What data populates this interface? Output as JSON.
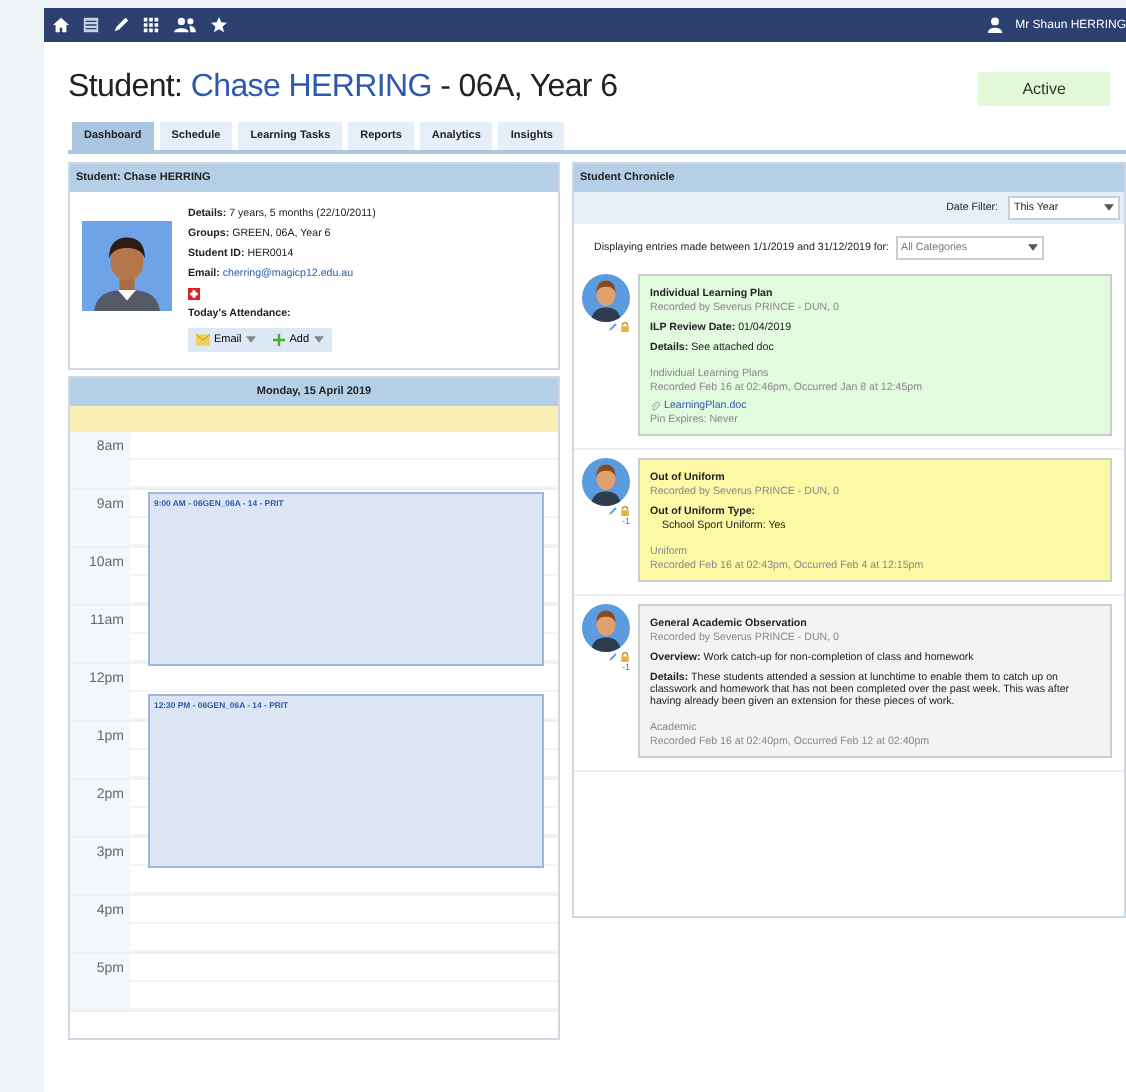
{
  "topbar": {
    "user": "Mr Shaun HERRING"
  },
  "header": {
    "prefix": "Student:",
    "name": "Chase HERRING",
    "suffix": "- 06A, Year 6",
    "status": "Active"
  },
  "tabs": [
    {
      "label": "Dashboard",
      "selected": true
    },
    {
      "label": "Schedule",
      "selected": false
    },
    {
      "label": "Learning Tasks",
      "selected": false
    },
    {
      "label": "Reports",
      "selected": false
    },
    {
      "label": "Analytics",
      "selected": false
    },
    {
      "label": "Insights",
      "selected": false
    }
  ],
  "student_panel": {
    "title": "Student: Chase HERRING",
    "details": [
      {
        "label": "Details:",
        "value": "7 years, 5 months (22/10/2011)"
      },
      {
        "label": "Groups:",
        "value": "GREEN, 06A, Year 6"
      },
      {
        "label": "Student ID:",
        "value": "HER0014"
      }
    ],
    "email_label": "Email:",
    "email": "cherring@magicp12.edu.au",
    "attendance_label": "Today's Attendance:",
    "buttons": [
      {
        "label": "Email",
        "kind": "email"
      },
      {
        "label": "Add",
        "kind": "add"
      }
    ]
  },
  "calendar": {
    "title": "Monday, 15 April 2019",
    "hours": [
      "8am",
      "9am",
      "10am",
      "11am",
      "12pm",
      "1pm",
      "2pm",
      "3pm",
      "4pm",
      "5pm"
    ],
    "events": [
      {
        "label": "9:00 AM - 06GEN_06A - 14 - PRIT"
      },
      {
        "label": "12:30 PM - 06GEN_06A - 14 - PRIT"
      }
    ]
  },
  "chronicle": {
    "title": "Student Chronicle",
    "date_filter_label": "Date Filter:",
    "date_filter": "This Year",
    "range_text": "Displaying entries made between 1/1/2019 and 31/12/2019 for:",
    "category": "All Categories",
    "entries": [
      {
        "title": "Individual Learning Plan",
        "recorded_by": "Recorded by Severus PRINCE - DUN, 0",
        "color": "#e2fbde",
        "fields": [
          {
            "label": "ILP Review Date:",
            "value": "01/04/2019",
            "kind": "inline"
          },
          {
            "label": "Details:",
            "value": "See attached doc",
            "kind": "inline"
          }
        ],
        "category": "Individual Learning Plans",
        "timestamp": "Recorded Feb 16 at 02:46pm, Occurred Jan 8 at 12:45pm",
        "attachment": "LearningPlan.doc",
        "pin": "Pin Expires: Never"
      },
      {
        "title": "Out of Uniform",
        "recorded_by": "Recorded by Severus PRINCE - DUN, 0",
        "color": "#fbf9a6",
        "count": "-1",
        "fields": [
          {
            "label": "Out of Uniform Type:",
            "value": "School Sport Uniform: Yes",
            "kind": "block"
          }
        ],
        "category": "Uniform",
        "timestamp": "Recorded Feb 16 at 02:43pm, Occurred Feb 4 at 12:15pm"
      },
      {
        "title": "General Academic Observation",
        "recorded_by": "Recorded by Severus PRINCE - DUN, 0",
        "color": "#f3f3f3",
        "count": "-1",
        "fields": [
          {
            "label": "Overview:",
            "value": "Work catch-up for non-completion of class and homework",
            "kind": "inline"
          },
          {
            "label": "Details:",
            "value": "These students attended a session at lunchtime to enable them to catch up on classwork and homework that has not been completed over the past week. This was after having already been given an extension for these pieces of work.",
            "kind": "inline"
          }
        ],
        "category": "Academic",
        "timestamp": "Recorded Feb 16 at 02:40pm, Occurred Feb 12 at 02:40pm"
      }
    ]
  }
}
